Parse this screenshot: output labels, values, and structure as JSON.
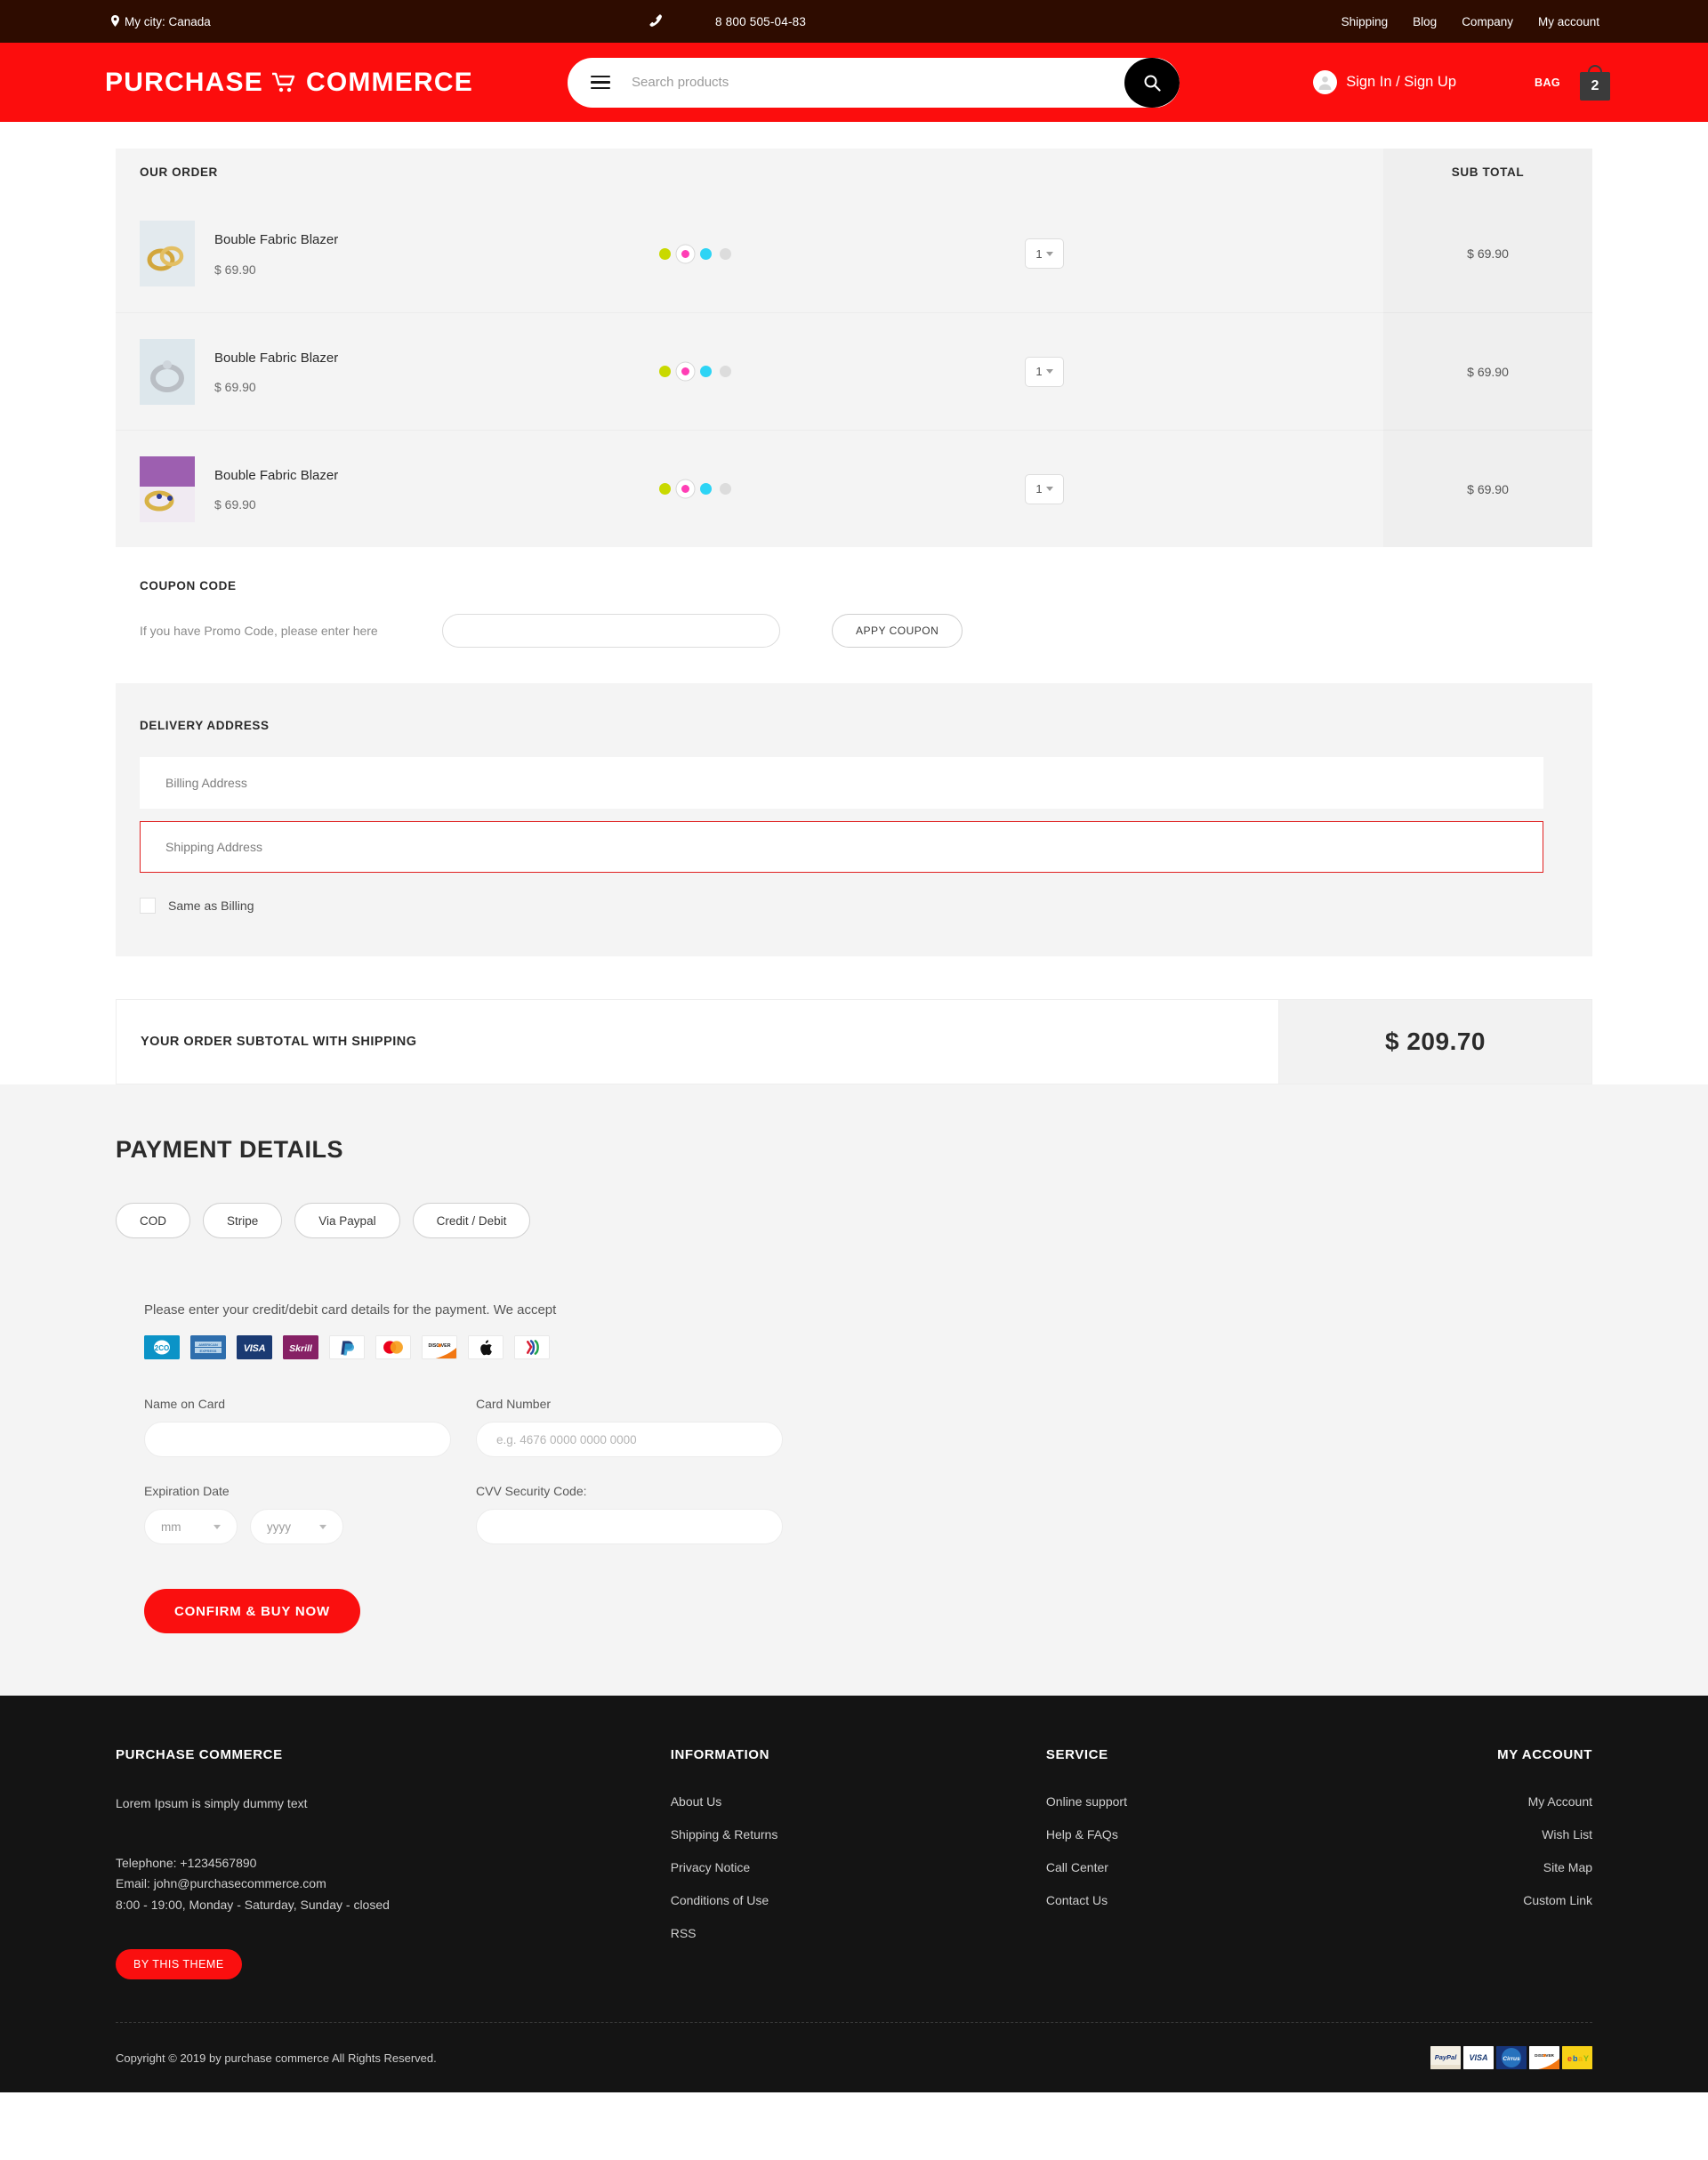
{
  "topbar": {
    "city_label": "My city: Canada",
    "phone": "8 800 505-04-83",
    "nav": [
      {
        "label": "Shipping"
      },
      {
        "label": "Blog"
      },
      {
        "label": "Company"
      },
      {
        "label": "My account"
      }
    ]
  },
  "header": {
    "logo_first": "PURCHASE",
    "logo_second": "COMMERCE",
    "search_placeholder": "Search products",
    "search_value": "",
    "signin_label": "Sign In / Sign Up",
    "bag_label": "BAG",
    "bag_count": "2"
  },
  "order": {
    "heading": "OUR ORDER",
    "subtotal_heading": "SUB TOTAL",
    "items": [
      {
        "name": "Bouble Fabric Blazer",
        "price": "$ 69.90",
        "qty": "1",
        "subtotal": "$ 69.90",
        "thumb": "gold-rings-photo",
        "colors": [
          "#c9d900",
          "#ff3eb5",
          "#2dd4f5",
          "#dcdcdc"
        ],
        "selected_color_index": 1
      },
      {
        "name": "Bouble Fabric Blazer",
        "price": "$ 69.90",
        "qty": "1",
        "subtotal": "$ 69.90",
        "thumb": "silver-ring-photo",
        "colors": [
          "#c9d900",
          "#ff3eb5",
          "#2dd4f5",
          "#dcdcdc"
        ],
        "selected_color_index": 1
      },
      {
        "name": "Bouble Fabric Blazer",
        "price": "$ 69.90",
        "qty": "1",
        "subtotal": "$ 69.90",
        "thumb": "gold-blue-rings-photo",
        "colors": [
          "#c9d900",
          "#ff3eb5",
          "#2dd4f5",
          "#dcdcdc"
        ],
        "selected_color_index": 1
      }
    ]
  },
  "coupon": {
    "title": "COUPON CODE",
    "hint": "If you have Promo Code, please enter here",
    "input_value": "",
    "button_label": "APPY COUPON"
  },
  "delivery": {
    "title": "DELIVERY ADDRESS",
    "billing_placeholder": "Billing Address",
    "billing_value": "",
    "shipping_placeholder": "Shipping Address",
    "shipping_value": "",
    "same_as_billing_label": "Same as Billing",
    "same_as_billing_checked": false,
    "error_color": "#e02020"
  },
  "subtotal_bar": {
    "label": "YOUR ORDER SUBTOTAL WITH SHIPPING",
    "amount": "$ 209.70"
  },
  "payment": {
    "title": "PAYMENT DETAILS",
    "tabs": [
      {
        "label": "COD"
      },
      {
        "label": "Stripe"
      },
      {
        "label": "Via Paypal"
      },
      {
        "label": "Credit / Debit"
      }
    ],
    "active_tab_index": 3,
    "note": "Please enter your credit/debit card details for the payment. We accept",
    "accepted_cards": [
      {
        "name": "2checkout-icon",
        "text": "2CO"
      },
      {
        "name": "american-express-icon",
        "text": "AMERICAN EXPRESS"
      },
      {
        "name": "visa-icon",
        "text": "VISA"
      },
      {
        "name": "skrill-icon",
        "text": "Skrill"
      },
      {
        "name": "paypal-icon",
        "text": "P"
      },
      {
        "name": "mastercard-icon",
        "text": ""
      },
      {
        "name": "discover-icon",
        "text": "DISC VER"
      },
      {
        "name": "apple-pay-icon",
        "text": ""
      },
      {
        "name": "multicolor-pay-icon",
        "text": ""
      }
    ],
    "fields": {
      "name_on_card_label": "Name on Card",
      "name_on_card_value": "",
      "card_number_label": "Card Number",
      "card_number_placeholder": "e.g. 4676 0000 0000 0000",
      "card_number_value": "",
      "expiration_label": "Expiration Date",
      "month_value": "mm",
      "year_value": "yyyy",
      "cvv_label": "CVV Security Code:",
      "cvv_value": ""
    },
    "confirm_label": "CONFIRM & BUY NOW",
    "accent_color": "#fa0f0f"
  },
  "footer": {
    "brand": {
      "title": "PURCHASE COMMERCE",
      "tagline": "Lorem Ipsum is simply dummy text",
      "telephone": "Telephone: +1234567890",
      "email": "Email: john@purchasecommerce.com",
      "hours": "8:00 - 19:00, Monday - Saturday, Sunday - closed",
      "theme_button": "BY THIS THEME"
    },
    "information": {
      "title": "INFORMATION",
      "links": [
        {
          "label": "About Us"
        },
        {
          "label": "Shipping & Returns"
        },
        {
          "label": "Privacy Notice"
        },
        {
          "label": "Conditions of Use"
        },
        {
          "label": "RSS"
        }
      ]
    },
    "service": {
      "title": "SERVICE",
      "links": [
        {
          "label": "Online support"
        },
        {
          "label": "Help & FAQs"
        },
        {
          "label": "Call Center"
        },
        {
          "label": "Contact Us"
        }
      ]
    },
    "my_account": {
      "title": "MY ACCOUNT",
      "links": [
        {
          "label": "My Account"
        },
        {
          "label": "Wish List"
        },
        {
          "label": "Site Map"
        },
        {
          "label": "Custom Link"
        }
      ]
    },
    "copyright": "Copyright © 2019 by purchase commerce All Rights Reserved.",
    "payment_badges": [
      {
        "name": "paypal-badge-icon",
        "text": "PayPal"
      },
      {
        "name": "visa-badge-icon",
        "text": "VISA"
      },
      {
        "name": "cirrus-badge-icon",
        "text": "Cirrus"
      },
      {
        "name": "discover-badge-icon",
        "text": "DISCOVER"
      },
      {
        "name": "ebay-badge-icon",
        "text": "ebaY"
      }
    ]
  }
}
